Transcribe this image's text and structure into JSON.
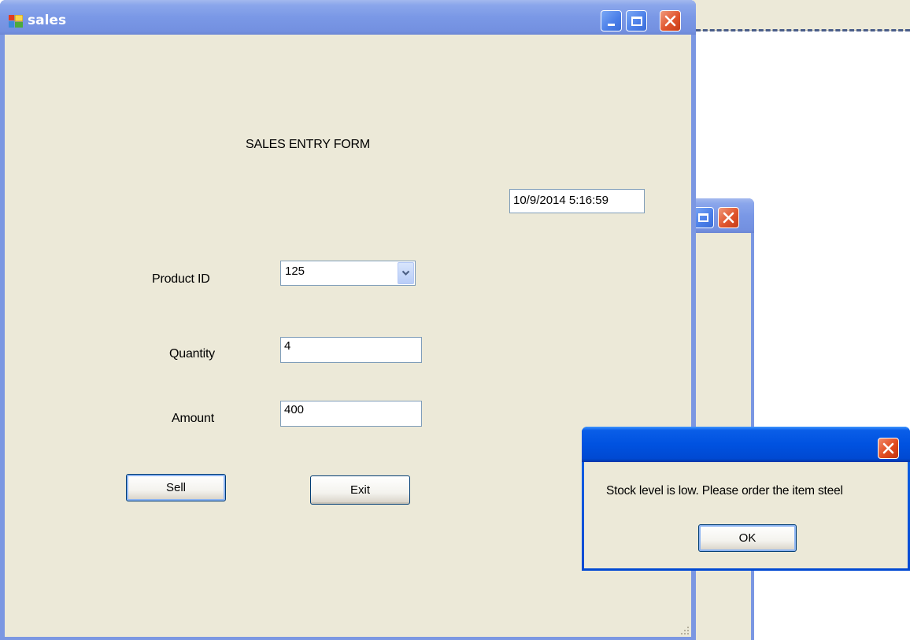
{
  "main_window": {
    "title": "sales",
    "heading": "SALES ENTRY FORM",
    "datetime": "10/9/2014 5:16:59",
    "product_id_label": "Product ID",
    "product_id_value": "125",
    "quantity_label": "Quantity",
    "quantity_value": "4",
    "amount_label": "Amount",
    "amount_value": "400",
    "sell_label": "Sell",
    "exit_label": "Exit"
  },
  "message_box": {
    "title": "",
    "message": "Stock level is low. Please order the item steel",
    "ok_label": "OK"
  },
  "icons": [
    "app-icon",
    "minimize-icon",
    "maximize-icon",
    "close-icon",
    "chevron-down-icon",
    "resize-grip-icon"
  ],
  "colors": {
    "xp_blue": "#0054e3",
    "inactive_title": "#7a98e6",
    "window_face": "#ece9d8",
    "close_red": "#e0552d"
  }
}
